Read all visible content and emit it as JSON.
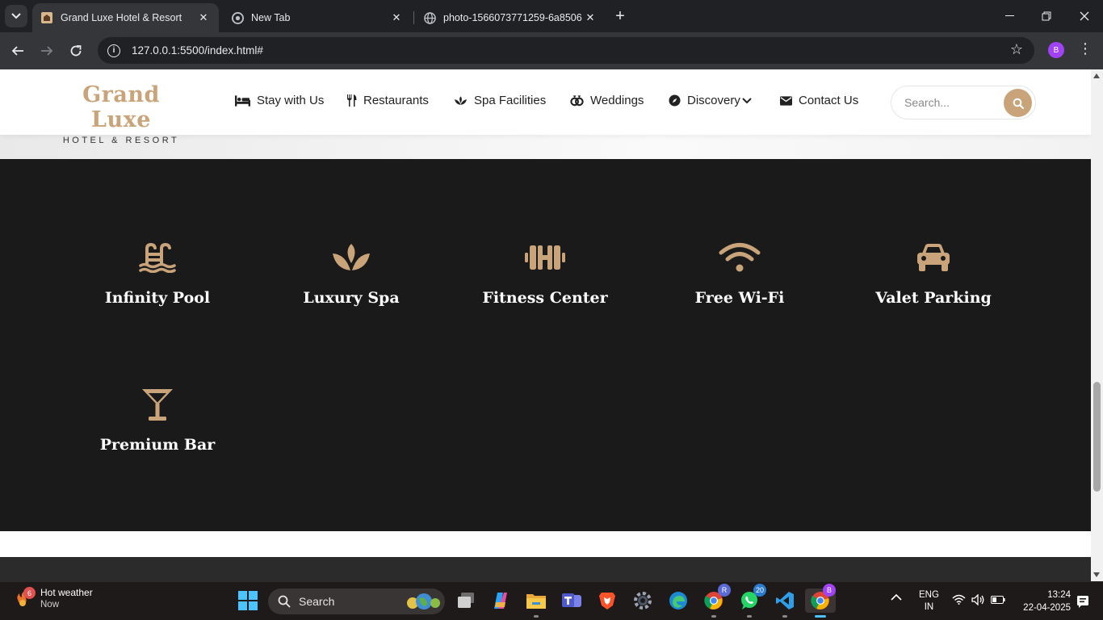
{
  "browser": {
    "tabs": [
      {
        "title": "Grand Luxe Hotel & Resort",
        "active": true
      },
      {
        "title": "New Tab",
        "active": false
      },
      {
        "title": "photo-1566073771259-6a8506",
        "active": false
      }
    ],
    "url": "127.0.0.1:5500/index.html#",
    "profile_initial": "B"
  },
  "site": {
    "logo_name": "Grand Luxe",
    "logo_sub": "HOTEL & RESORT",
    "nav": [
      {
        "label": "Stay with Us",
        "icon": "bed-icon"
      },
      {
        "label": "Restaurants",
        "icon": "utensils-icon"
      },
      {
        "label": "Spa Facilities",
        "icon": "lotus-icon"
      },
      {
        "label": "Weddings",
        "icon": "rings-icon"
      },
      {
        "label": "Discovery",
        "icon": "compass-icon"
      },
      {
        "label": "Contact Us",
        "icon": "envelope-icon"
      }
    ],
    "search_placeholder": "Search..."
  },
  "amenities": [
    {
      "label": "Infinity Pool",
      "icon": "pool-icon"
    },
    {
      "label": "Luxury Spa",
      "icon": "spa-icon"
    },
    {
      "label": "Fitness Center",
      "icon": "dumbbell-icon"
    },
    {
      "label": "Free Wi-Fi",
      "icon": "wifi-icon"
    },
    {
      "label": "Valet Parking",
      "icon": "car-icon"
    },
    {
      "label": "Premium Bar",
      "icon": "cocktail-icon"
    }
  ],
  "colors": {
    "accent_gold": "#c9a47a",
    "amenity_bg": "#1b1a1a"
  },
  "taskbar": {
    "weather_title": "Hot weather",
    "weather_sub": "Now",
    "weather_badge": "6",
    "search_label": "Search",
    "chrome_badge": "R",
    "whatsapp_badge": "20",
    "active_chrome_badge": "B",
    "lang": "ENG",
    "region": "IN",
    "time": "13:24",
    "date": "22-04-2025"
  }
}
